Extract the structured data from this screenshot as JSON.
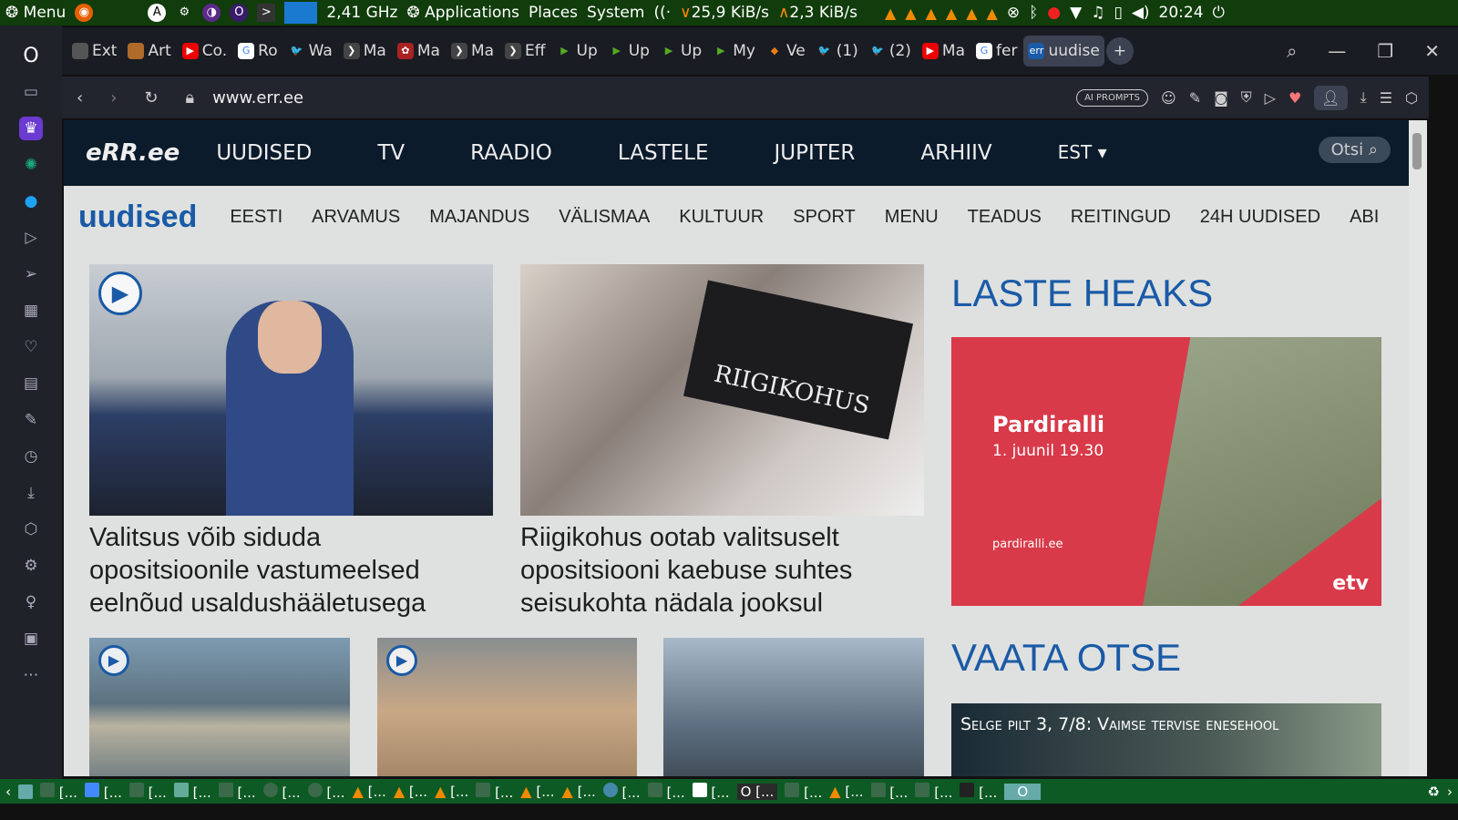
{
  "panel": {
    "menu": "Menu",
    "cpu": "2,41 GHz",
    "applications": "Applications",
    "places": "Places",
    "system": "System",
    "net_down": "25,9 KiB/s",
    "net_up": "2,3 KiB/s",
    "clock": "20:24"
  },
  "tabs": [
    {
      "label": "Ext",
      "color": "#555"
    },
    {
      "label": "Art",
      "color": "#b06a2a"
    },
    {
      "label": "Co.",
      "color": "#e00"
    },
    {
      "label": "Ro",
      "color": "#4285f4"
    },
    {
      "label": "Wa",
      "color": "#1da1f2"
    },
    {
      "label": "Ma",
      "color": "#444"
    },
    {
      "label": "Ma",
      "color": "#a22"
    },
    {
      "label": "Ma",
      "color": "#444"
    },
    {
      "label": "Eff",
      "color": "#444"
    },
    {
      "label": "Up",
      "color": "#5a2"
    },
    {
      "label": "Up",
      "color": "#5a2"
    },
    {
      "label": "Up",
      "color": "#5a2"
    },
    {
      "label": "My",
      "color": "#5a2"
    },
    {
      "label": "Ve",
      "color": "#e87a1b"
    },
    {
      "label": "(1)",
      "color": "#1da1f2"
    },
    {
      "label": "(2)",
      "color": "#1da1f2"
    },
    {
      "label": "Ma",
      "color": "#e00"
    },
    {
      "label": "fer",
      "color": "#4285f4"
    },
    {
      "label": "uudise",
      "color": "#1a5aa6",
      "active": true
    }
  ],
  "address": {
    "url": "www.err.ee",
    "ai_prompts": "AI PROMPTS"
  },
  "site": {
    "logo": "eRR.ee",
    "nav": [
      "UUDISED",
      "TV",
      "RAADIO",
      "LASTELE",
      "JUPITER",
      "ARHIIV"
    ],
    "lang": "EST ▾",
    "search": "Otsi",
    "brand": "uudised",
    "subnav": [
      "EESTI",
      "ARVAMUS",
      "MAJANDUS",
      "VÄLISMAA",
      "KULTUUR",
      "SPORT",
      "MENU",
      "TEADUS",
      "REITINGUD",
      "24H UUDISED",
      "ABI"
    ]
  },
  "articles": [
    {
      "headline": "Valitsus võib siduda opositsioonile vastumeelsed eelnõud usaldushääletusega"
    },
    {
      "headline": "Riigikohus ootab valitsuselt opositsiooni kaebuse suhtes seisukohta nädala jooksul",
      "image_text": "RIIGIKOHUS"
    }
  ],
  "right": {
    "laste_heaks": "LASTE HEAKS",
    "promo_title": "Pardiralli",
    "promo_date": "1. juunil 19.30",
    "promo_url": "pardiralli.ee",
    "promo_channel": "etv",
    "vaata_otse": "VAATA OTSE",
    "live_title": "Selge pilt 3, 7/8: Vaimse tervise enesehool"
  },
  "taskbar": {
    "item": "[..."
  }
}
